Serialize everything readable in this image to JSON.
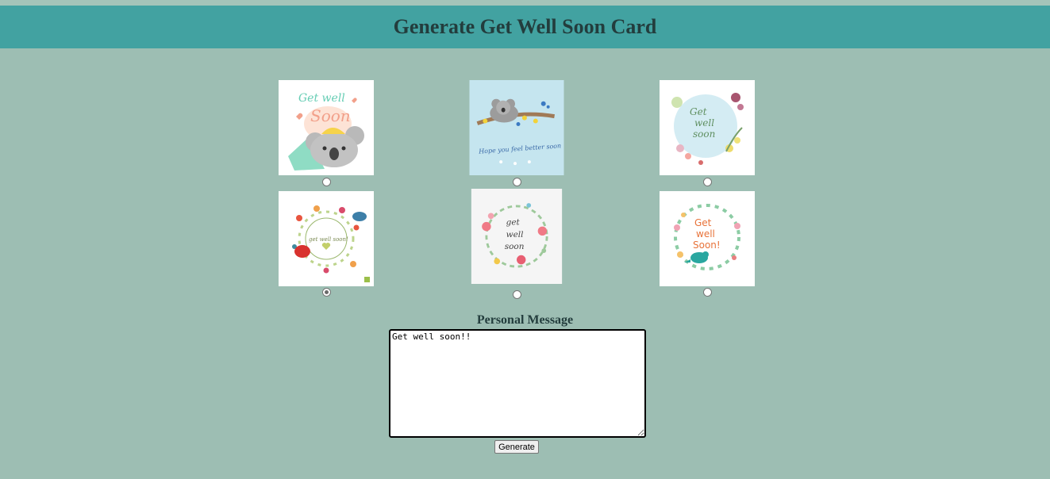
{
  "page": {
    "title": "Generate Get Well Soon Card",
    "background_color": "#9dbeb3",
    "header_color": "#42a2a1"
  },
  "cards": [
    {
      "id": "card-1",
      "text": "Get well Soon",
      "theme": "koala-with-blanket",
      "selected": false
    },
    {
      "id": "card-2",
      "text": "Hope you feel better soon",
      "theme": "koala-on-branch",
      "selected": false
    },
    {
      "id": "card-3",
      "text": "Get well soon",
      "theme": "watercolor-floral",
      "selected": false
    },
    {
      "id": "card-4",
      "text": "get well soon!",
      "theme": "birds-floral-wreath",
      "selected": true
    },
    {
      "id": "card-5",
      "text": "get well soon",
      "theme": "floral-wreath",
      "selected": false
    },
    {
      "id": "card-6",
      "text": "Get well Soon!",
      "theme": "bird-leaf-wreath",
      "selected": false
    }
  ],
  "message": {
    "label": "Personal Message",
    "value": "Get well soon!!"
  },
  "generate_button": {
    "label": "Generate"
  }
}
